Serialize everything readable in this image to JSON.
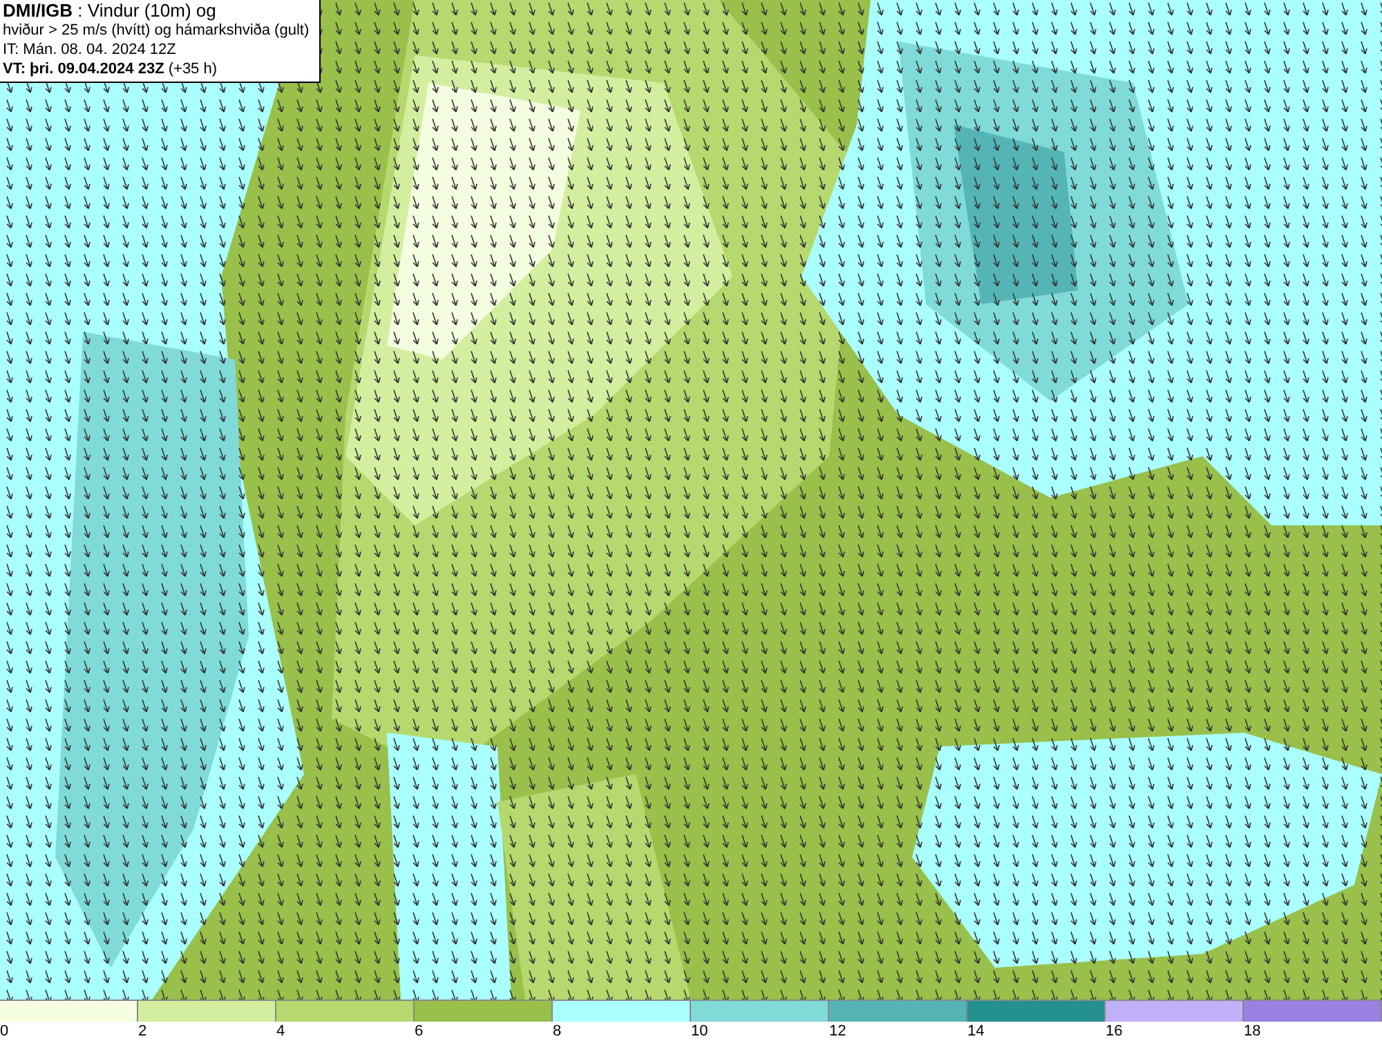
{
  "title_box": {
    "lines": [
      "**DMI/IGB** : Vindur (10m) og",
      "hviður > 25 m/s (hvítt) og hámarkshviða (gult)",
      "IT: Mán. 08. 04. 2024 12Z",
      "**VT: þri. 09.04.2024 23Z** (+35 h)"
    ]
  },
  "legend": {
    "bins": [
      {
        "color": "#f5fde0"
      },
      {
        "color": "#d4eea0"
      },
      {
        "color": "#b5d96e"
      },
      {
        "color": "#98c04a"
      },
      {
        "color": "#aaffff"
      },
      {
        "color": "#80dbd8"
      },
      {
        "color": "#55b5b5"
      },
      {
        "color": "#259090"
      },
      {
        "color": "#c0b0f8"
      },
      {
        "color": "#9a80e0"
      }
    ],
    "ticks": [
      "0",
      "2",
      "4",
      "6",
      "8",
      "10",
      "12",
      "14",
      "16",
      "18"
    ]
  }
}
